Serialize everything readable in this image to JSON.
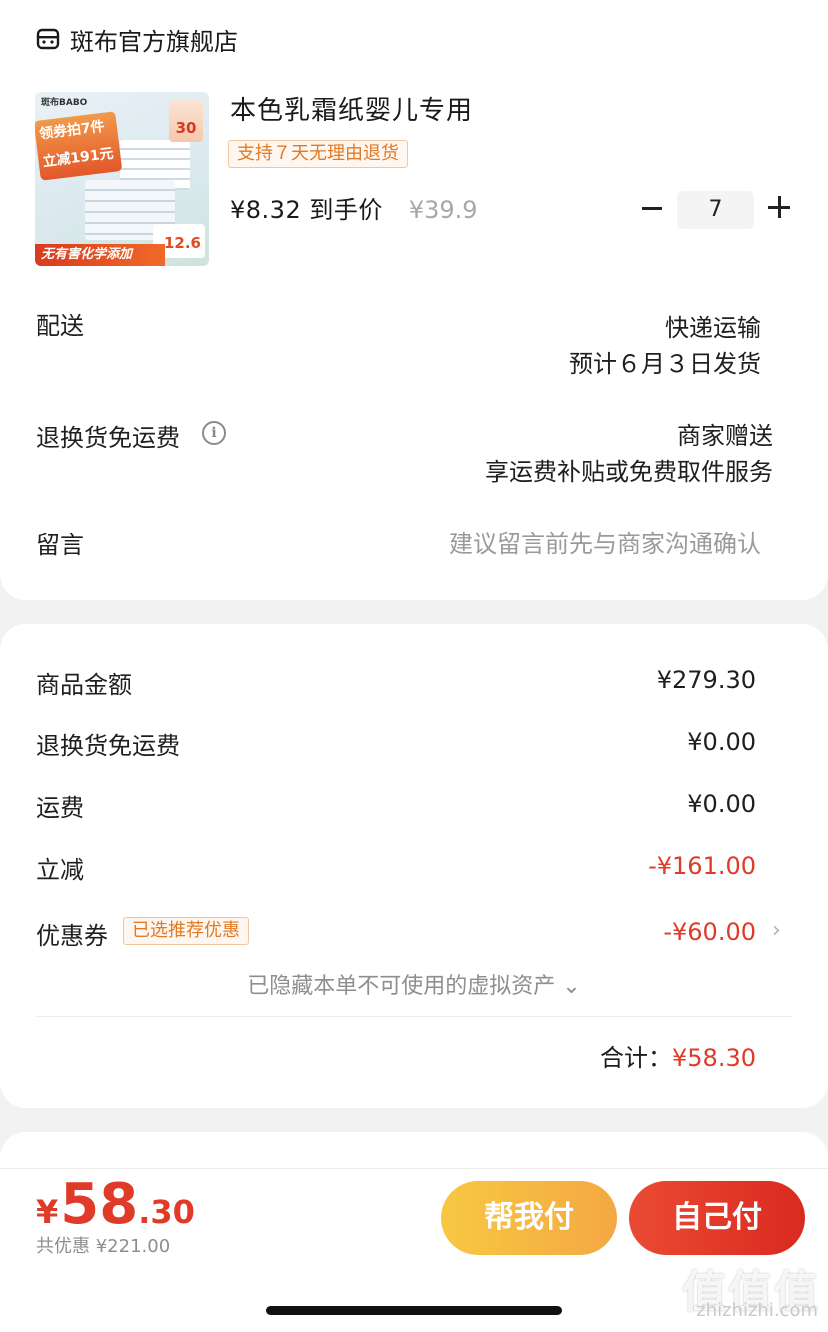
{
  "store": {
    "name": "斑布官方旗舰店"
  },
  "product": {
    "image": {
      "brand": "斑布BABO",
      "promo_left": "领券拍7件 立减191元",
      "promo_right": "30",
      "price_tag": "12.6",
      "banner": "无有害化学添加"
    },
    "title": "本色乳霜纸婴儿专用",
    "return_tag": "支持７天无理由退货",
    "final_price": "¥8.32 到手价",
    "original_price": "¥39.9",
    "quantity": "7"
  },
  "delivery": {
    "label": "配送",
    "method": "快递运输",
    "eta": "预计６月３日发货"
  },
  "return_shipping": {
    "label": "退换货免运费",
    "value_line1": "商家赠送",
    "value_line2": "享运费补贴或免费取件服务"
  },
  "message": {
    "label": "留言",
    "placeholder": "建议留言前先与商家沟通确认"
  },
  "summary": {
    "goods_amount_label": "商品金额",
    "goods_amount": "¥279.30",
    "return_free_label": "退换货免运费",
    "return_free": "¥0.00",
    "shipping_label": "运费",
    "shipping": "¥0.00",
    "discount_label": "立减",
    "discount": "-¥161.00",
    "coupon_label": "优惠券",
    "coupon_tag": "已选推荐优惠",
    "coupon": "-¥60.00",
    "hidden_assets": "已隐藏本单不可使用的虚拟资产 ⌄",
    "total_label": "合计：",
    "total": "¥58.30"
  },
  "bottom": {
    "currency": "¥",
    "price_int": "58",
    "price_dec": ".30",
    "saved": "共优惠 ¥221.00",
    "help_pay_label": "帮我付",
    "self_pay_label": "自己付"
  },
  "watermark": {
    "text": "值值值",
    "sub": "zhizhizhi.com"
  },
  "colors": {
    "accent_red": "#e03a28",
    "tag_orange": "#e07a26",
    "btn_yellow": "#f7c842"
  }
}
